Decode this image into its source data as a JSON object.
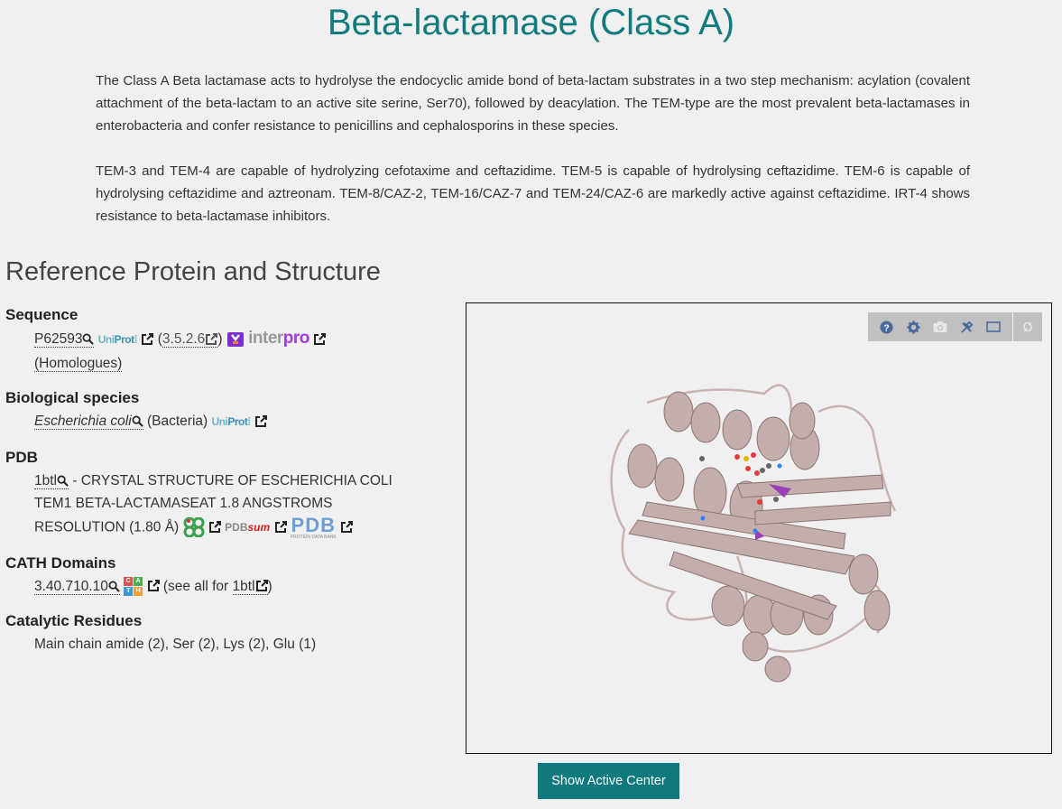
{
  "page": {
    "title": "Beta-lactamase (Class A)",
    "description": [
      "The Class A Beta lactamase acts to hydrolyse the endocyclic amide bond of beta-lactam substrates in a two step mechanism: acylation (covalent attachment of the beta-lactam to an active site serine, Ser70), followed by deacylation. The TEM-type are the most prevalent beta-lactamases in enterobacteria and confer resistance to penicillins and cephalosporins in these species.",
      "TEM-3 and TEM-4 are capable of hydrolyzing cefotaxime and ceftazidime. TEM-5 is capable of hydrolysing ceftazidime. TEM-6 is capable of hydrolysing ceftazidime and aztreonam. TEM-8/CAZ-2, TEM-16/CAZ-7 and TEM-24/CAZ-6 are markedly active against ceftazidime. IRT-4 shows resistance to beta-lactamase inhibitors."
    ]
  },
  "reference": {
    "section_title": "Reference Protein and Structure",
    "sequence": {
      "heading": "Sequence",
      "uniprot_id": "P62593",
      "ec_open": "(",
      "ec_number": "3.5.2.6",
      "ec_close": ")",
      "homologues": "(Homologues)",
      "uniprot_logo_a": "Uni",
      "uniprot_logo_b": "Prot",
      "interpro_logo_a": "inter",
      "interpro_logo_b": "pro"
    },
    "species": {
      "heading": "Biological species",
      "name": "Escherichia coli",
      "kingdom": "(Bacteria)"
    },
    "pdb": {
      "heading": "PDB",
      "id": "1btl",
      "description": "- CRYSTAL STRUCTURE OF ESCHERICHIA COLI TEM1 BETA-LACTAMASEAT 1.8 ANGSTROMS RESOLUTION (1.80 Å)",
      "pdbsum_a": "PDB",
      "pdbsum_b": "sum",
      "rcsb_label": "PDB",
      "rcsb_sub": "PROTEIN DATA BANK"
    },
    "cath": {
      "heading": "CATH Domains",
      "domain": "3.40.710.10",
      "see_all_prefix": "(see all for",
      "see_all_id": "1btl",
      "see_all_suffix": ")",
      "logo_letters": [
        "C",
        "A",
        "T",
        "H"
      ],
      "logo_colors": [
        "#d9534f",
        "#4cae4c",
        "#3a9ad9",
        "#f0a030"
      ]
    },
    "catalytic": {
      "heading": "Catalytic Residues",
      "residues": "Main chain amide (2), Ser (2), Lys (2), Glu (1)"
    }
  },
  "viewer": {
    "toolbar_icons": [
      "help-icon",
      "settings-icon",
      "camera-icon",
      "tools-icon",
      "expand-icon",
      "reset-icon"
    ]
  },
  "actions": {
    "show_active_center": "Show Active Center"
  }
}
